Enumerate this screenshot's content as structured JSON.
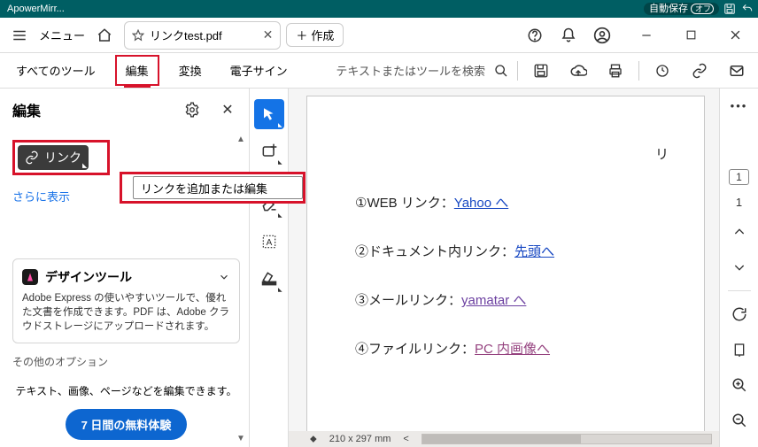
{
  "titlebar": {
    "app": "ApowerMirr...",
    "autosave_label": "自動保存",
    "autosave_state": "オフ"
  },
  "toolbar": {
    "menu": "メニュー",
    "tab_title": "リンクtest.pdf",
    "new_tab": "作成"
  },
  "subbar": {
    "all_tools": "すべてのツール",
    "edit": "編集",
    "convert": "変換",
    "esign": "電子サイン",
    "search_placeholder": "テキストまたはツールを検索"
  },
  "panel": {
    "title": "編集",
    "link_btn": "リンク",
    "more": "さらに表示",
    "tooltip": "リンクを追加または編集",
    "design_title": "デザインツール",
    "design_desc": "Adobe Express の使いやすいツールで、優れた文書を作成できます。PDF は、Adobe クラウドストレージにアップロードされます。",
    "other": "その他のオプション",
    "edit_msg": "テキスト、画像、ページなどを編集できます。",
    "trial": "7 日間の無料体験"
  },
  "doc": {
    "heading_frag": "リ",
    "row1_pre": "①WEB リンク：",
    "row1_link": "Yahoo へ",
    "row2_pre": "②ドキュメント内リンク：",
    "row2_link": "先頭へ",
    "row3_pre": "③メールリンク：",
    "row3_link": "yamatar へ",
    "row4_pre": "④ファイルリンク：",
    "row4_link": "PC 内画像へ",
    "page_size": "210 x 297 mm"
  },
  "right": {
    "page_current": "1",
    "page_total": "1"
  }
}
